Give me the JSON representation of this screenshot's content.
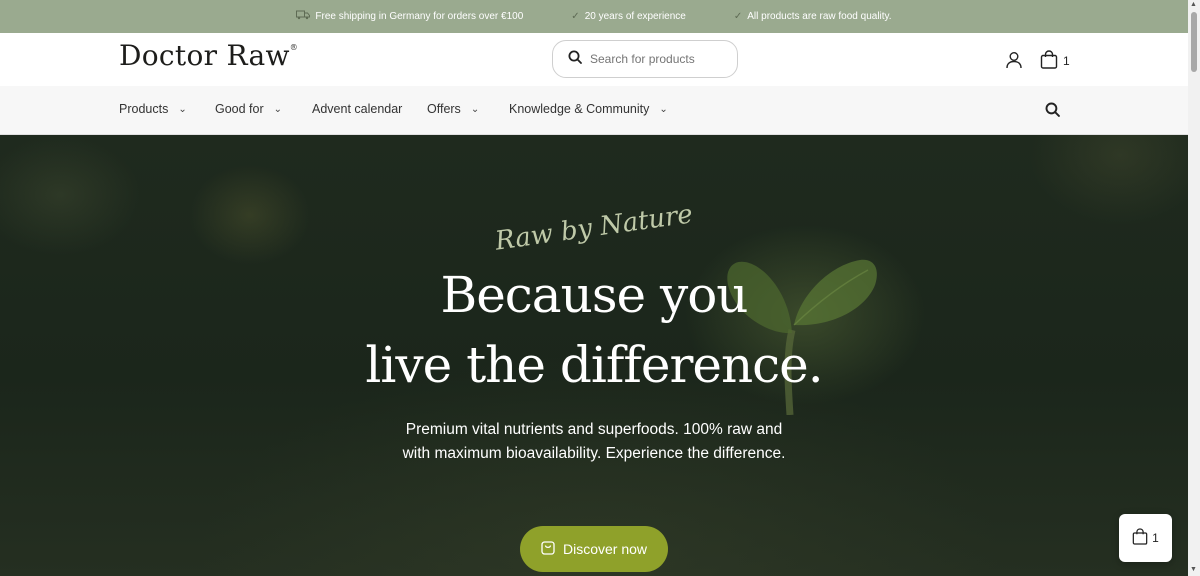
{
  "topbar": {
    "usps": [
      {
        "icon": "truck-icon",
        "text": "Free shipping in Germany for orders over €100"
      },
      {
        "icon": "check-icon",
        "text": "20 years of experience"
      },
      {
        "icon": "check-icon",
        "text": "All products are raw food quality."
      }
    ]
  },
  "header": {
    "logo": "Doctor Raw",
    "logo_mark": "®",
    "search_placeholder": "Search for products",
    "cart_count": "1"
  },
  "nav": {
    "items": [
      {
        "label": "Products",
        "dropdown": true
      },
      {
        "label": "Good for",
        "dropdown": true
      },
      {
        "label": "Advent calendar",
        "dropdown": false
      },
      {
        "label": "Offers",
        "dropdown": true
      },
      {
        "label": "Knowledge & Community",
        "dropdown": true
      }
    ]
  },
  "hero": {
    "tagline": "Raw by Nature",
    "headline_line1": "Because you",
    "headline_line2": "live the difference.",
    "subtext": "Premium vital nutrients and superfoods. 100% raw and with maximum bioavailability. Experience the difference.",
    "cta_label": "Discover now"
  },
  "floating_cart": {
    "count": "1"
  },
  "colors": {
    "topbar": "#9aaa8f",
    "cta": "#8fa12a",
    "hero_dark": "#1f2a1e"
  }
}
